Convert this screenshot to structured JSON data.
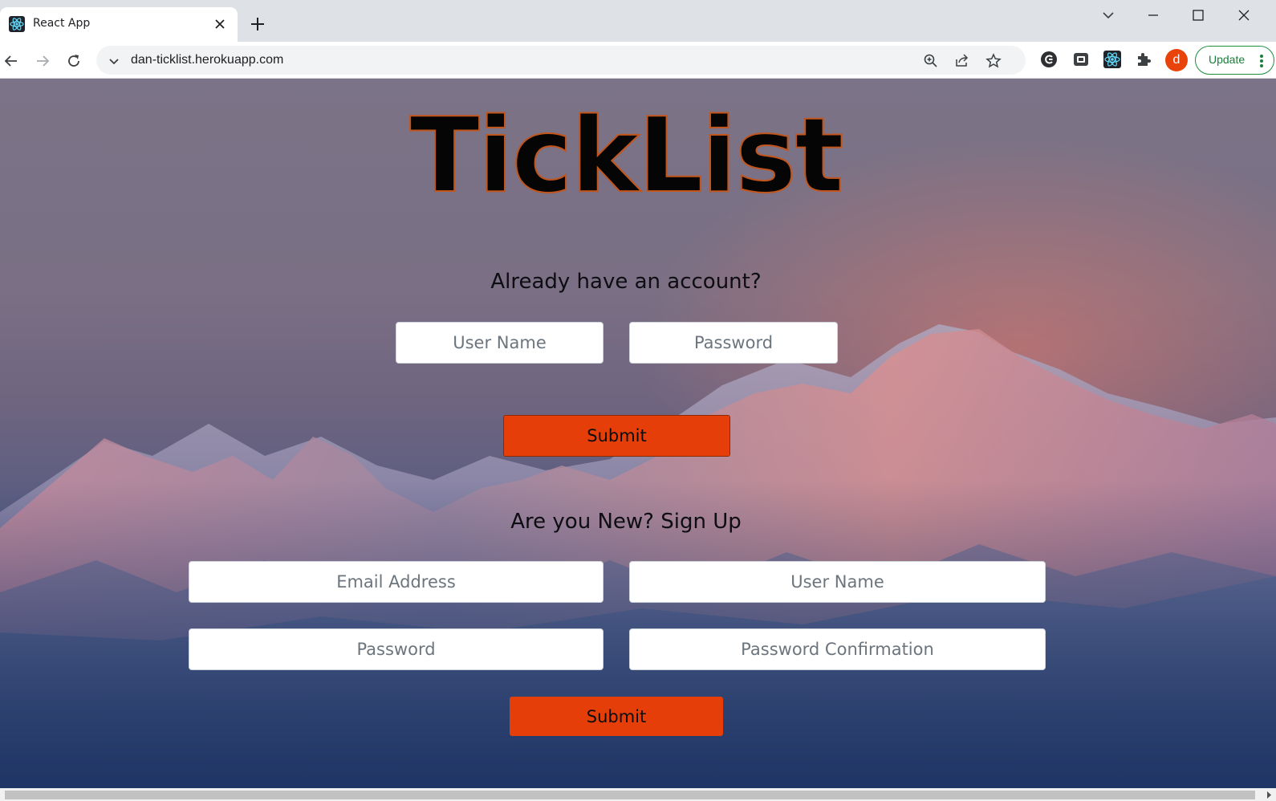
{
  "browser": {
    "tab": {
      "title": "React App"
    },
    "address_bar": {
      "url": "dan-ticklist.herokuapp.com"
    },
    "profile": {
      "initial": "d"
    },
    "update_button": {
      "label": "Update"
    }
  },
  "page": {
    "brand": "TickList",
    "login": {
      "heading": "Already have an account?",
      "username_placeholder": "User Name",
      "password_placeholder": "Password",
      "submit_label": "Submit"
    },
    "signup": {
      "heading": "Are you New? Sign Up",
      "email_placeholder": "Email Address",
      "username_placeholder": "User Name",
      "password_placeholder": "Password",
      "password_confirmation_placeholder": "Password Confirmation",
      "submit_label": "Submit"
    }
  },
  "colors": {
    "submit_button": "#e63e08",
    "profile_avatar": "#e8430a",
    "update_accent": "#188038"
  },
  "icons": {
    "tab_favicon": "react-atom-icon",
    "extensions": [
      "grammar-extension-icon",
      "reader-extension-icon",
      "react-devtools-icon",
      "puzzle-extensions-icon"
    ]
  }
}
